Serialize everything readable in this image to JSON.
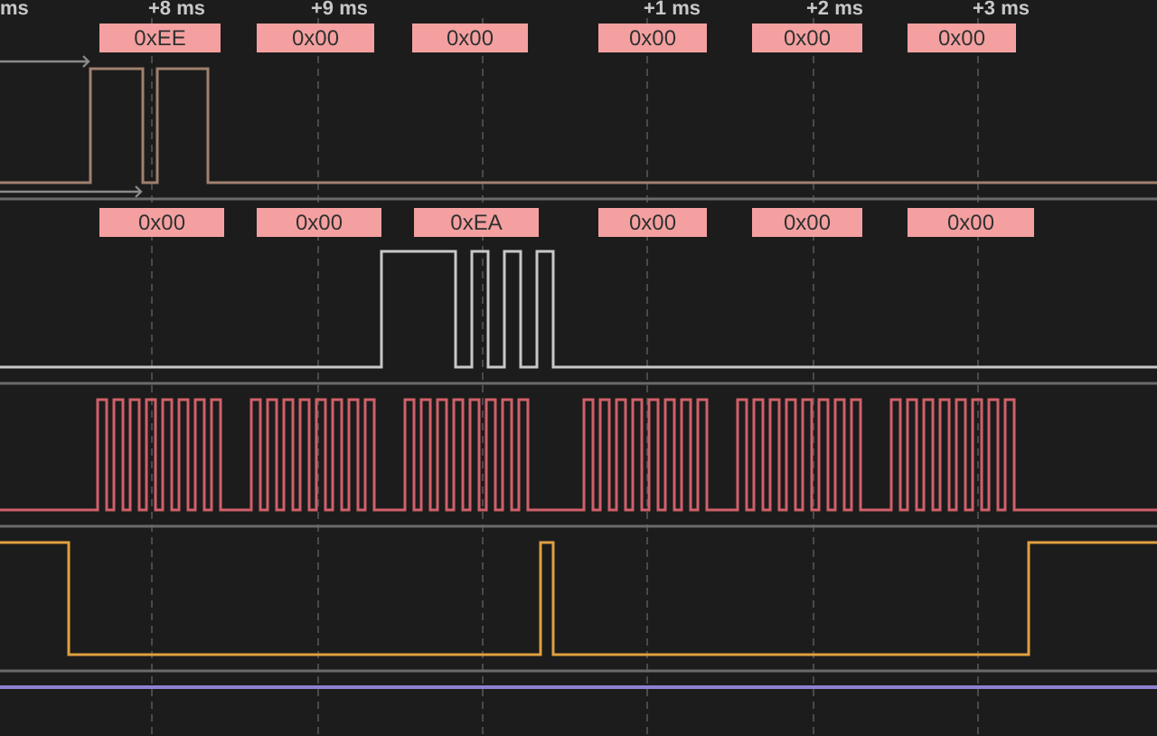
{
  "time_ruler": {
    "labels": [
      "ms",
      "+8 ms",
      "+9 ms",
      "+1 ms",
      "+2 ms",
      "+3 ms"
    ]
  },
  "channels": [
    {
      "color": "#a0806f",
      "decoded": [
        "0xEE",
        "0x00",
        "0x00",
        "0x00",
        "0x00",
        "0x00"
      ]
    },
    {
      "color": "#c8c8c8",
      "decoded": [
        "0x00",
        "0x00",
        "0xEA",
        "0x00",
        "0x00",
        "0x00"
      ]
    },
    {
      "color": "#d0606a"
    },
    {
      "color": "#e0a040"
    },
    {
      "color": "#9080d0"
    }
  ]
}
